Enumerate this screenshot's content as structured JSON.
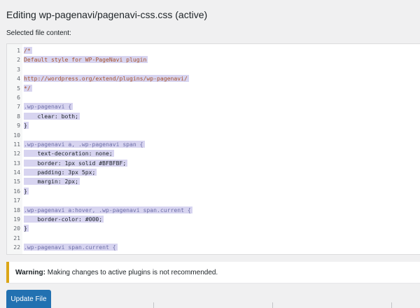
{
  "page": {
    "title": "Editing wp-pagenavi/pagenavi-css.css (active)",
    "selected_label": "Selected file content:"
  },
  "editor": {
    "lines": [
      {
        "n": "1",
        "t": "/*"
      },
      {
        "n": "2",
        "t": "Default style for WP-PageNavi plugin"
      },
      {
        "n": "3",
        "t": ""
      },
      {
        "n": "4",
        "t": "http://wordpress.org/extend/plugins/wp-pagenavi/"
      },
      {
        "n": "5",
        "t": "*/"
      },
      {
        "n": "6",
        "t": ""
      },
      {
        "n": "7",
        "t": ".wp-pagenavi {"
      },
      {
        "n": "8",
        "t": "    clear: both;"
      },
      {
        "n": "9",
        "t": "}"
      },
      {
        "n": "10",
        "t": ""
      },
      {
        "n": "11",
        "t": ".wp-pagenavi a, .wp-pagenavi span {"
      },
      {
        "n": "12",
        "t": "    text-decoration: none;"
      },
      {
        "n": "13",
        "t": "    border: 1px solid #BFBFBF;"
      },
      {
        "n": "14",
        "t": "    padding: 3px 5px;"
      },
      {
        "n": "15",
        "t": "    margin: 2px;"
      },
      {
        "n": "16",
        "t": "}"
      },
      {
        "n": "17",
        "t": ""
      },
      {
        "n": "18",
        "t": ".wp-pagenavi a:hover, .wp-pagenavi span.current {"
      },
      {
        "n": "19",
        "t": "    border-color: #000;"
      },
      {
        "n": "20",
        "t": "}"
      },
      {
        "n": "21",
        "t": ""
      },
      {
        "n": "22",
        "t": ".wp-pagenavi span.current {"
      }
    ]
  },
  "warning": {
    "label": "Warning:",
    "message": " Making changes to active plugins is not recommended."
  },
  "actions": {
    "update_label": "Update File"
  },
  "colors": {
    "accent": "#2271b1",
    "warning_border": "#dba617",
    "selection": "#d7d4f0"
  }
}
